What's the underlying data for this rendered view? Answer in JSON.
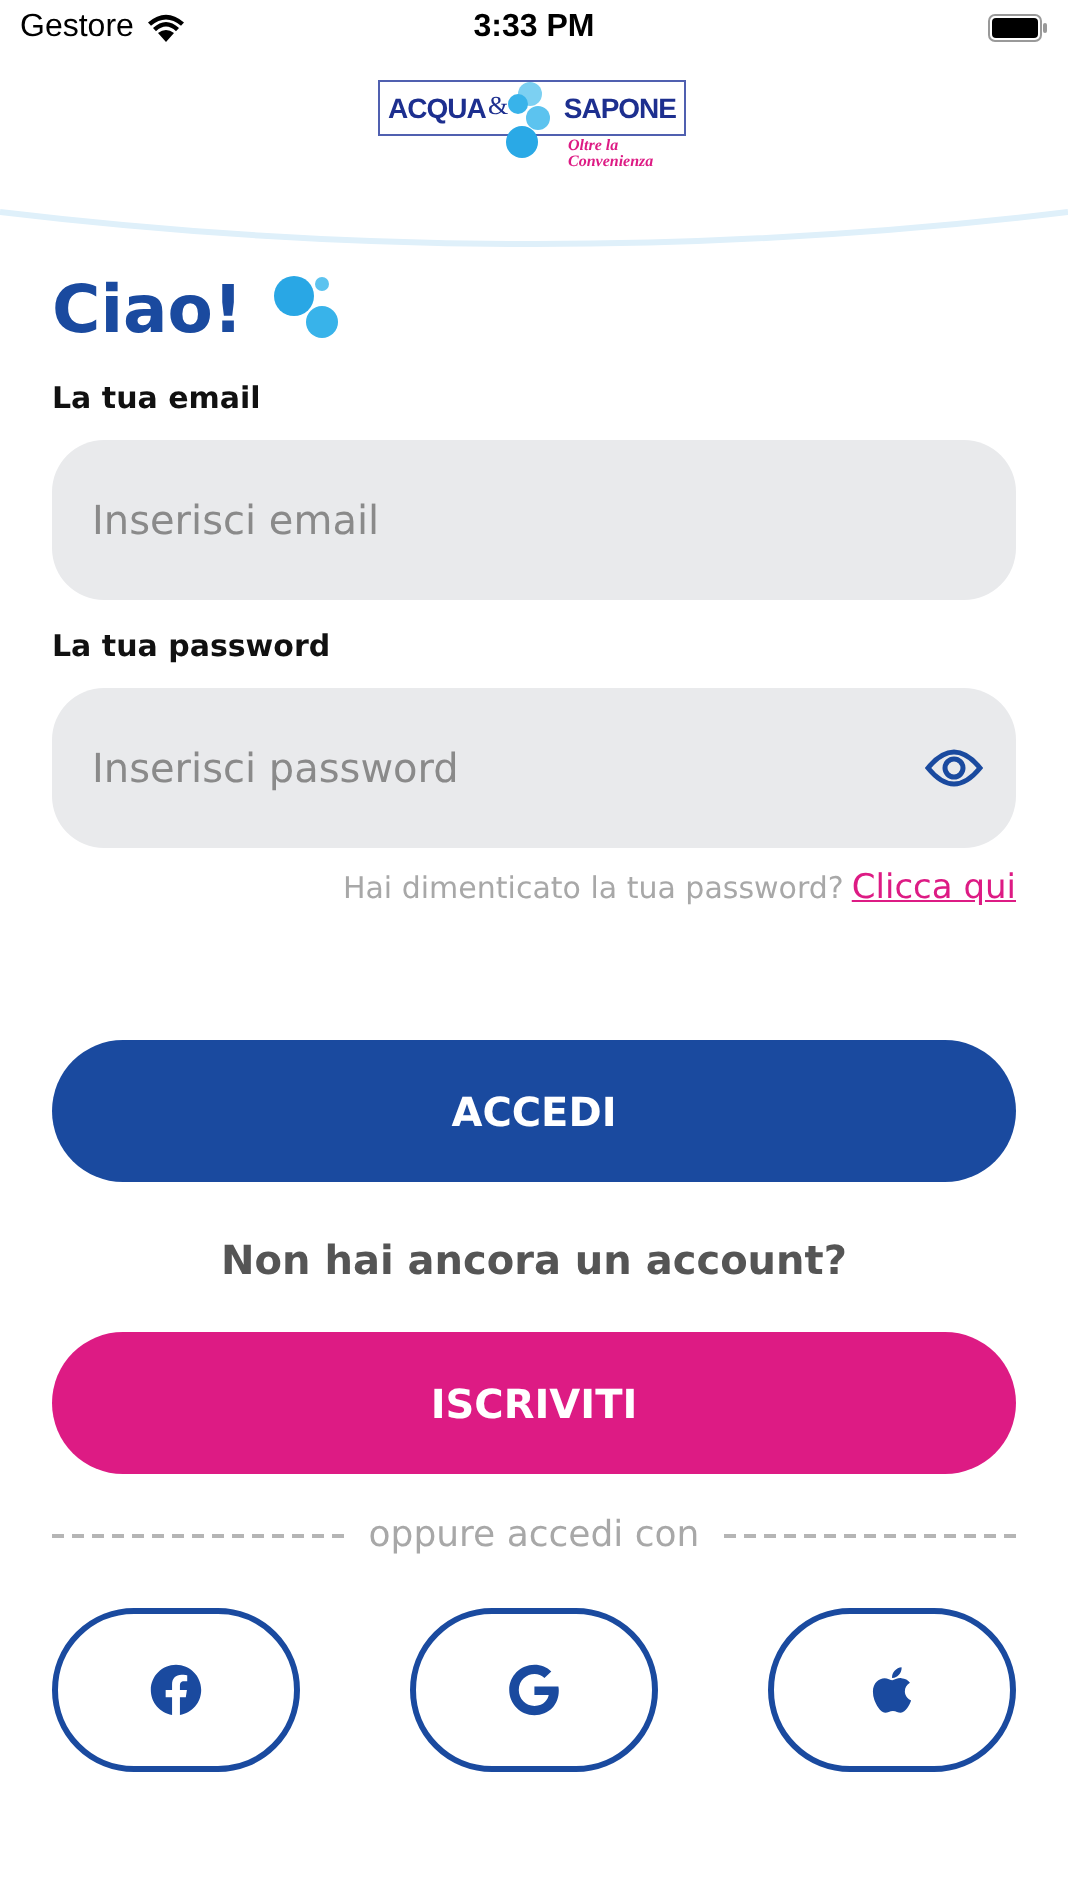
{
  "status_bar": {
    "carrier": "Gestore",
    "time": "3:33 PM"
  },
  "logo": {
    "word_1": "ACQUA",
    "ampersand": "&",
    "word_2": "SAPONE",
    "tagline_1": "Oltre la",
    "tagline_2": "Convenienza"
  },
  "greeting": "Ciao!",
  "email": {
    "label": "La tua email",
    "placeholder": "Inserisci email"
  },
  "password": {
    "label": "La tua password",
    "placeholder": "Inserisci password"
  },
  "forgot": {
    "text": "Hai dimenticato la tua password?",
    "link": "Clicca qui"
  },
  "login_button": "ACCEDI",
  "no_account": "Non hai ancora un account?",
  "signup_button": "ISCRIVITI",
  "divider_text": "oppure accedi con",
  "social": [
    {
      "kind": "facebook"
    },
    {
      "kind": "google"
    },
    {
      "kind": "apple"
    }
  ]
}
